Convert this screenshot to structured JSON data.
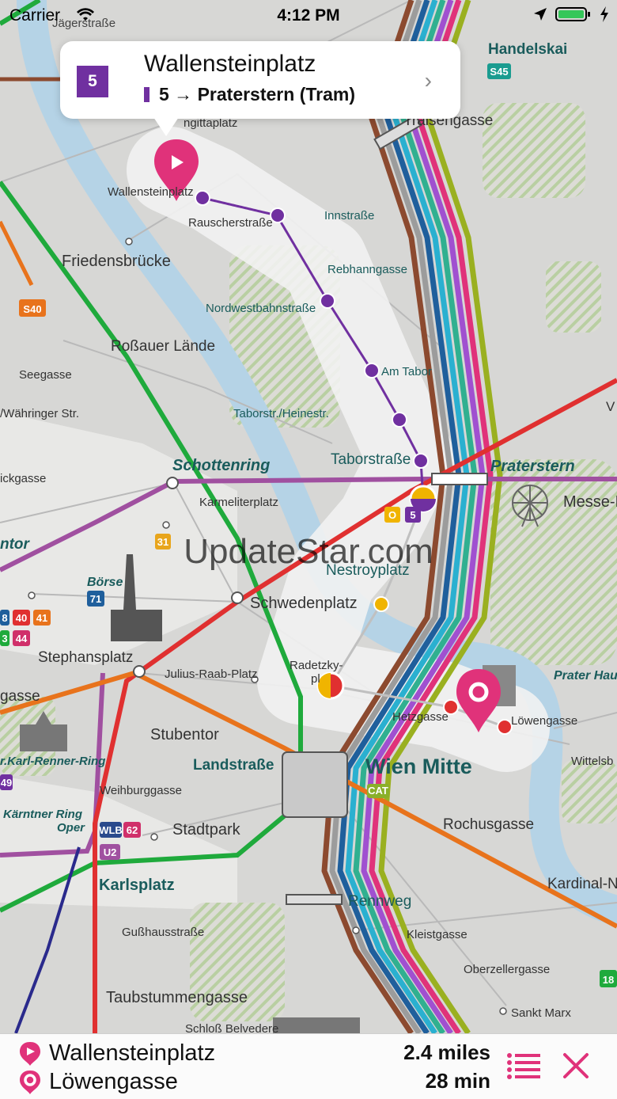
{
  "status_bar": {
    "carrier": "Carrier",
    "time": "4:12 PM"
  },
  "callout": {
    "line_badge": "5",
    "title": "Wallensteinplatz",
    "subtitle": "5 → Praterstern (Tram)"
  },
  "watermark": "UpdateStar.com",
  "map": {
    "labels": [
      {
        "t": "Jägerstraße"
      },
      {
        "t": "Handelskai"
      },
      {
        "t": "Traisengasse"
      },
      {
        "t": "ngittaplatz"
      },
      {
        "t": "Wallensteinplatz"
      },
      {
        "t": "Rauscherstraße"
      },
      {
        "t": "Innstraße"
      },
      {
        "t": "Friedensbrücke"
      },
      {
        "t": "Rebhanngasse"
      },
      {
        "t": "Nordwestbahnstraße"
      },
      {
        "t": "Roßauer Lände"
      },
      {
        "t": "Seegasse"
      },
      {
        "t": "Am Tabor"
      },
      {
        "t": "/Währinger Str."
      },
      {
        "t": "Taborstr./Heinestr."
      },
      {
        "t": "Taborstraße"
      },
      {
        "t": "Schottenring"
      },
      {
        "t": "Praterstern"
      },
      {
        "t": "Messe-P"
      },
      {
        "t": "ickgasse"
      },
      {
        "t": "Karmeliterplatz"
      },
      {
        "t": "ntor"
      },
      {
        "t": "Nestroyplatz"
      },
      {
        "t": "Börse"
      },
      {
        "t": "Schwedenplatz"
      },
      {
        "t": "Stephansplatz"
      },
      {
        "t": "Radetzky-"
      },
      {
        "t": "pl"
      },
      {
        "t": "Julius-Raab-Platz"
      },
      {
        "t": "Prater Hau"
      },
      {
        "t": "gasse"
      },
      {
        "t": "Hetzgasse"
      },
      {
        "t": "Löwengasse"
      },
      {
        "t": "Stubentor"
      },
      {
        "t": "Wittelsb"
      },
      {
        "t": "r.Karl-Renner-Ring"
      },
      {
        "t": "Landstraße"
      },
      {
        "t": "Wien Mitte"
      },
      {
        "t": "Weihburggasse"
      },
      {
        "t": "Kärntner Ring"
      },
      {
        "t": "Oper"
      },
      {
        "t": "Stadtpark"
      },
      {
        "t": "Rochusgasse"
      },
      {
        "t": "Karlsplatz"
      },
      {
        "t": "Kardinal-N"
      },
      {
        "t": "Rennweg"
      },
      {
        "t": "Gußhausstraße"
      },
      {
        "t": "Kleistgasse"
      },
      {
        "t": "Oberzellergasse"
      },
      {
        "t": "Taubstummengasse"
      },
      {
        "t": "Sankt Marx"
      },
      {
        "t": "Schloß Belvedere"
      },
      {
        "t": "V"
      }
    ],
    "badges": [
      {
        "t": "S45",
        "color": "#1a9c90"
      },
      {
        "t": "S40",
        "color": "#e8731c"
      },
      {
        "t": "31",
        "color": "#e8a51c"
      },
      {
        "t": "71",
        "color": "#1f5f9c"
      },
      {
        "t": "8",
        "color": "#1f5f9c"
      },
      {
        "t": "40",
        "color": "#e03030"
      },
      {
        "t": "41",
        "color": "#e8731c"
      },
      {
        "t": "3",
        "color": "#1faa3c"
      },
      {
        "t": "44",
        "color": "#d0306a"
      },
      {
        "t": "O",
        "color": "#f0b400"
      },
      {
        "t": "5",
        "color": "#7030a0"
      },
      {
        "t": "CAT",
        "color": "#8ab02a"
      },
      {
        "t": "WLB",
        "color": "#2a4a8c"
      },
      {
        "t": "62",
        "color": "#d0306a"
      },
      {
        "t": "U2",
        "color": "#a050a0"
      },
      {
        "t": "49",
        "color": "#7030a0"
      },
      {
        "t": "18",
        "color": "#1faa3c"
      }
    ]
  },
  "route": {
    "from": "Wallensteinplatz",
    "to": "Löwengasse",
    "distance": "2.4 miles",
    "duration": "28 min"
  },
  "colors": {
    "accent": "#e0327a",
    "tram_purple": "#7030a0",
    "u4_green": "#1faa3c",
    "u2_purple": "#a050a0",
    "u1_red": "#e03030",
    "u3_orange": "#e8731c"
  }
}
